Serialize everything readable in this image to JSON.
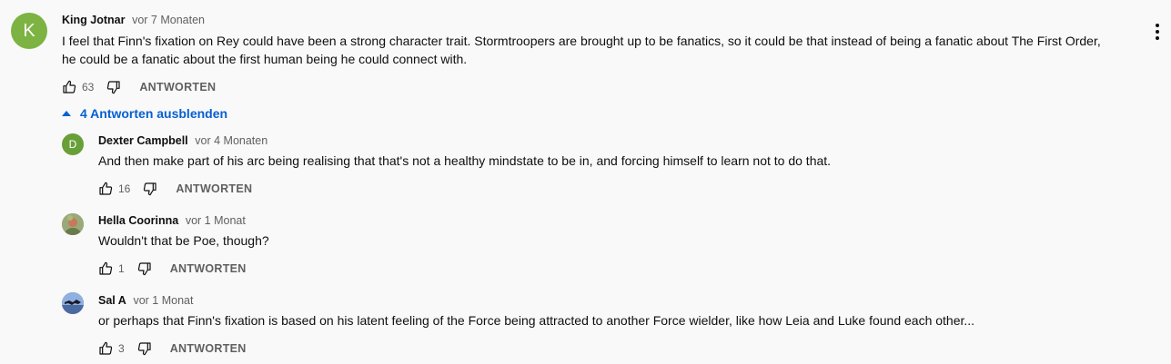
{
  "colors": {
    "link": "#065fd4",
    "meta": "#606060",
    "text": "#0f0f0f",
    "background": "#f9f9f9"
  },
  "icons": {
    "like": "thumbs-up-icon",
    "dislike": "thumbs-down-icon",
    "menu": "more-vert-icon",
    "collapse": "caret-up-icon"
  },
  "main_comment": {
    "avatar_letter": "K",
    "avatar_color": "#7cb342",
    "author": "King Jotnar",
    "time": "vor 7 Monaten",
    "text": "I feel that Finn's fixation on Rey could have been a strong character trait. Stormtroopers are brought up to be fanatics, so it could be that instead of being a fanatic about The First Order, he could be a fanatic about the first human being he could connect with.",
    "likes": "63",
    "reply_label": "ANTWORTEN"
  },
  "replies_toggle": {
    "label": "4 Antworten ausblenden"
  },
  "replies": [
    {
      "avatar_letter": "D",
      "avatar_color": "#689f38",
      "author": "Dexter Campbell",
      "time": "vor 4 Monaten",
      "text": "And then make part of his arc being realising that that's not a healthy mindstate to be in, and forcing himself to learn not to do that.",
      "likes": "16",
      "reply_label": "ANTWORTEN"
    },
    {
      "avatar_letter": "",
      "avatar_color": "#8a9a6a",
      "author": "Hella Coorinna",
      "time": "vor 1 Monat",
      "text": "Wouldn't that be Poe, though?",
      "likes": "1",
      "reply_label": "ANTWORTEN"
    },
    {
      "avatar_letter": "",
      "avatar_color": "#5b7fb8",
      "author": "Sal A",
      "time": "vor 1 Monat",
      "text": "or perhaps that Finn's fixation is based on his latent feeling of the Force being attracted to another Force wielder, like how Leia and Luke found each other...",
      "likes": "3",
      "reply_label": "ANTWORTEN"
    }
  ]
}
